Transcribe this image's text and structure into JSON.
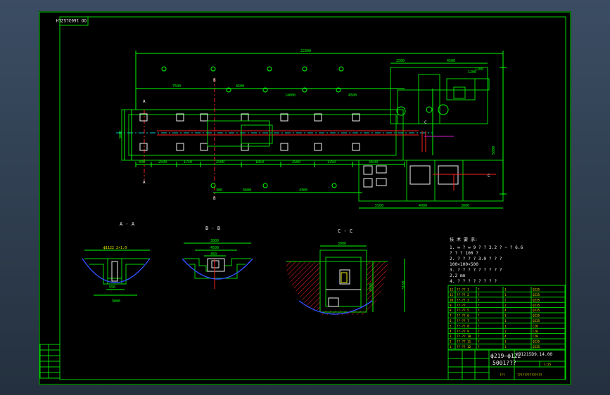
{
  "drawing": {
    "corner_code": "OO 1603LSZLH",
    "total_length": "22300",
    "views": {
      "section_a": "A - A",
      "section_b": "B - B",
      "section_c": "C - C"
    },
    "plan_dims": {
      "top_row": [
        "4500",
        "14000",
        "2500",
        "4500",
        "1200"
      ],
      "left_block": "7500",
      "mid_a": "1200",
      "bottom_row": [
        "800",
        "2500",
        "1750",
        "2500",
        "1850",
        "2500",
        "1750",
        "2500",
        "8500"
      ],
      "lower_right": [
        "5500",
        "4000",
        "3000"
      ],
      "extra": [
        "300",
        "4300",
        "3600"
      ]
    },
    "section_b_dims": [
      "3000",
      "4500",
      "450"
    ],
    "section_c_dims": [
      "3000",
      "3500",
      "3160"
    ],
    "pipe_label": "ϕ219~ϕ122",
    "pipe_sub": "5001???",
    "notes": {
      "heading": "技 术 要 求:",
      "lines": [
        "1. ∞ ? ∞ 9 ? ? 3.2 ? ~ ? 6.6",
        "   ? ? ? 100 ?",
        "2. ? ? ? ? 3.0 ? ? ?",
        "   100×100×500",
        "3. ? ? ? ? ? ? ? ? ?",
        "   2.2 mm",
        "4. ? ? ? ? ? ? ? ?"
      ]
    },
    "title_block": {
      "drawing_number": "HJ1215D9.14.00",
      "scale_text": "1:25",
      "company": "??????????????",
      "designer": "???",
      "bom_rows": [
        [
          "12",
          "??-?? 1",
          "?",
          "1",
          "Q235"
        ],
        [
          "11",
          "??-?? 2",
          "?",
          "1",
          "Q235"
        ],
        [
          "10",
          "??-?? 3",
          "?",
          "2",
          "Q235"
        ],
        [
          "9",
          "??-??",
          "?",
          "2",
          "Q235"
        ],
        [
          "8",
          "??-?? 5",
          "?",
          "4",
          "Q235"
        ],
        [
          "7",
          "??-?? 6",
          "?",
          "1",
          "Q235"
        ],
        [
          "6",
          "??-?? 7",
          "?",
          "1",
          "Q235"
        ],
        [
          "5",
          "??-?? 8",
          "?",
          "1",
          "C20"
        ],
        [
          "4",
          "??-?? 9",
          "?",
          "2",
          "C20"
        ],
        [
          "3",
          "??-?? 10",
          "?",
          "4",
          "C20"
        ],
        [
          "2",
          "??-?? 11",
          "?",
          "1",
          "Q235"
        ],
        [
          "1",
          "??-?? 12",
          "?",
          "1",
          "Q235"
        ]
      ]
    },
    "colors": {
      "frame": "#00d400",
      "dimension": "#00ff00",
      "centerline": "#00c8c8",
      "red_axis": "#ff2020",
      "text": "#f0f0f0",
      "title_accent": "#e8e800",
      "hatch": "#ff2020",
      "arc": "#3050ff"
    }
  }
}
